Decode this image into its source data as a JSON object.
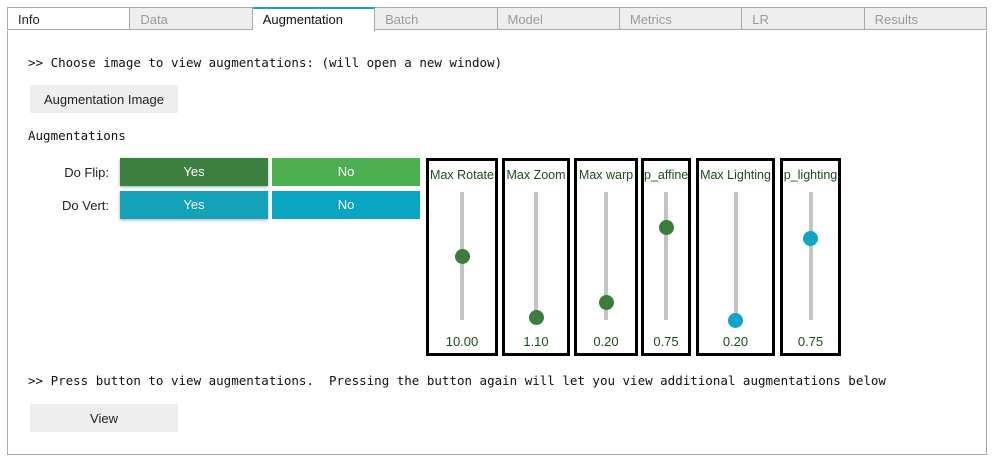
{
  "tabs": [
    {
      "label": "Info",
      "state": "plain"
    },
    {
      "label": "Data",
      "state": "inactive"
    },
    {
      "label": "Augmentation",
      "state": "active"
    },
    {
      "label": "Batch",
      "state": "inactive"
    },
    {
      "label": "Model",
      "state": "inactive"
    },
    {
      "label": "Metrics",
      "state": "inactive"
    },
    {
      "label": "LR",
      "state": "inactive"
    },
    {
      "label": "Results",
      "state": "inactive"
    }
  ],
  "choose_text": ">> Choose image to view augmentations: (will open a new window)",
  "augmentation_image_button": "Augmentation Image",
  "augmentations_heading": "Augmentations",
  "do_flip": {
    "label": "Do Flip:",
    "yes": "Yes",
    "no": "No",
    "selected": "Yes"
  },
  "do_vert": {
    "label": "Do Vert:",
    "yes": "Yes",
    "no": "No",
    "selected": "Yes"
  },
  "colors": {
    "green_selected": "#3b8040",
    "green": "#4caf50",
    "teal_selected": "#13a2b8",
    "teal": "#0aa5c2",
    "thumb_green": "#3a7d3d",
    "thumb_teal": "#0ea5c6"
  },
  "sliders": [
    {
      "title": "Max Rotate",
      "value": "10.00",
      "level": 0.5,
      "color": "green"
    },
    {
      "title": "Max Zoom",
      "value": "1.10",
      "level": 0.02,
      "color": "green"
    },
    {
      "title": "Max warp",
      "value": "0.20",
      "level": 0.14,
      "color": "green"
    },
    {
      "title": "p_affine",
      "value": "0.75",
      "level": 0.72,
      "color": "green"
    },
    {
      "title": "Max Lighting",
      "value": "0.20",
      "level": 0.0,
      "color": "teal"
    },
    {
      "title": "p_lighting",
      "value": "0.75",
      "level": 0.64,
      "color": "teal"
    }
  ],
  "press_text": ">> Press button to view augmentations.  Pressing the button again will let you view additional augmentations below",
  "view_button": "View"
}
